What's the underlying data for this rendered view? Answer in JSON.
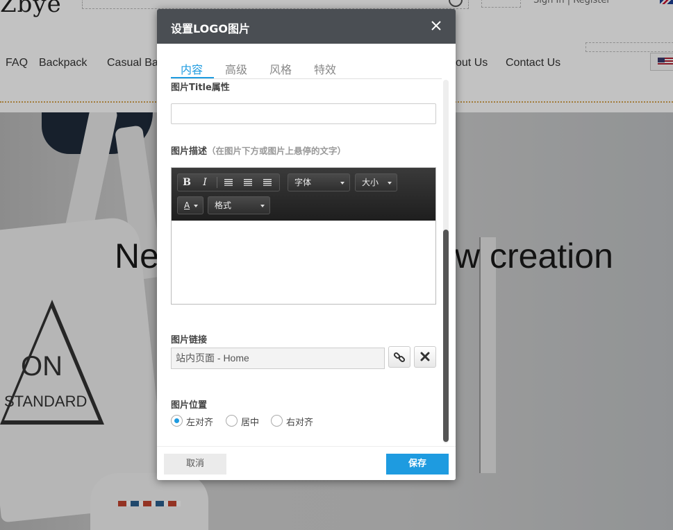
{
  "site": {
    "logo": "Zbye",
    "signin": "Sign In | Register",
    "nav": [
      "FAQ",
      "Backpack",
      "Casual Ba",
      "out Us",
      "Contact Us"
    ],
    "hero_left": "Ne",
    "hero_right": "w creation",
    "bag_print_1": "ON",
    "bag_print_2": "STANDARD"
  },
  "dialog": {
    "title": "设置LOGO图片",
    "close_icon": "close-icon",
    "tabs": [
      "内容",
      "高级",
      "风格",
      "特效"
    ],
    "active_tab": "内容",
    "title_attr_label": "图片Title属性",
    "title_attr_value": "",
    "desc_label": "图片描述",
    "desc_hint": "（在图片下方或图片上悬停的文字）",
    "editor": {
      "bold": "B",
      "italic": "I",
      "font_label": "字体",
      "size_label": "大小",
      "color_label": "A",
      "format_label": "格式",
      "content": ""
    },
    "link_label": "图片链接",
    "link_value": "站内页面 - Home",
    "position_label": "图片位置",
    "positions": [
      "左对齐",
      "居中",
      "右对齐"
    ],
    "selected_position": "左对齐",
    "cancel_label": "取消",
    "save_label": "保存",
    "accent_color": "#1e9be0",
    "header_color": "#4a4e53"
  }
}
